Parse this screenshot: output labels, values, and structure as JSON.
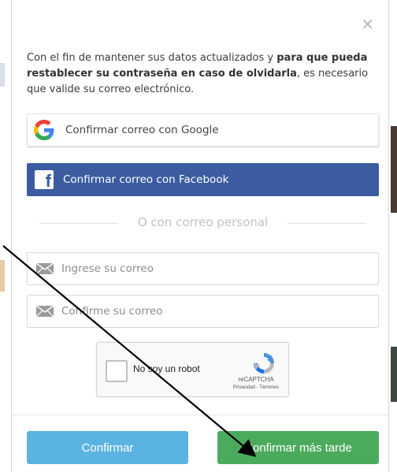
{
  "modal": {
    "close_symbol": "×",
    "intro": {
      "part1": "Con el fin de mantener sus datos actualizados y ",
      "bold": "para que pueda restablecer su contraseña en caso de olvidarla",
      "part2": ", es necesario que valide su correo electrónico."
    },
    "google_button": {
      "label": "Confirmar correo con Google",
      "icon": "google-g-icon"
    },
    "facebook_button": {
      "label": "Confirmar correo con Facebook",
      "icon": "facebook-f-icon",
      "color": "#3b5ca0"
    },
    "divider_text": "O con correo personal",
    "email_field": {
      "placeholder": "Ingrese su correo",
      "value": "",
      "icon": "envelope-icon"
    },
    "confirm_email_field": {
      "placeholder": "Confirme su correo",
      "value": "",
      "icon": "envelope-icon"
    },
    "captcha": {
      "label": "No soy un robot",
      "brand": "reCAPTCHA",
      "links": "Privacidad - Términos",
      "checked": false
    },
    "footer": {
      "confirm_label": "Confirmar",
      "confirm_color": "#5bb3e1",
      "later_label": "Confirmar más tarde",
      "later_color": "#4bab5c"
    }
  }
}
